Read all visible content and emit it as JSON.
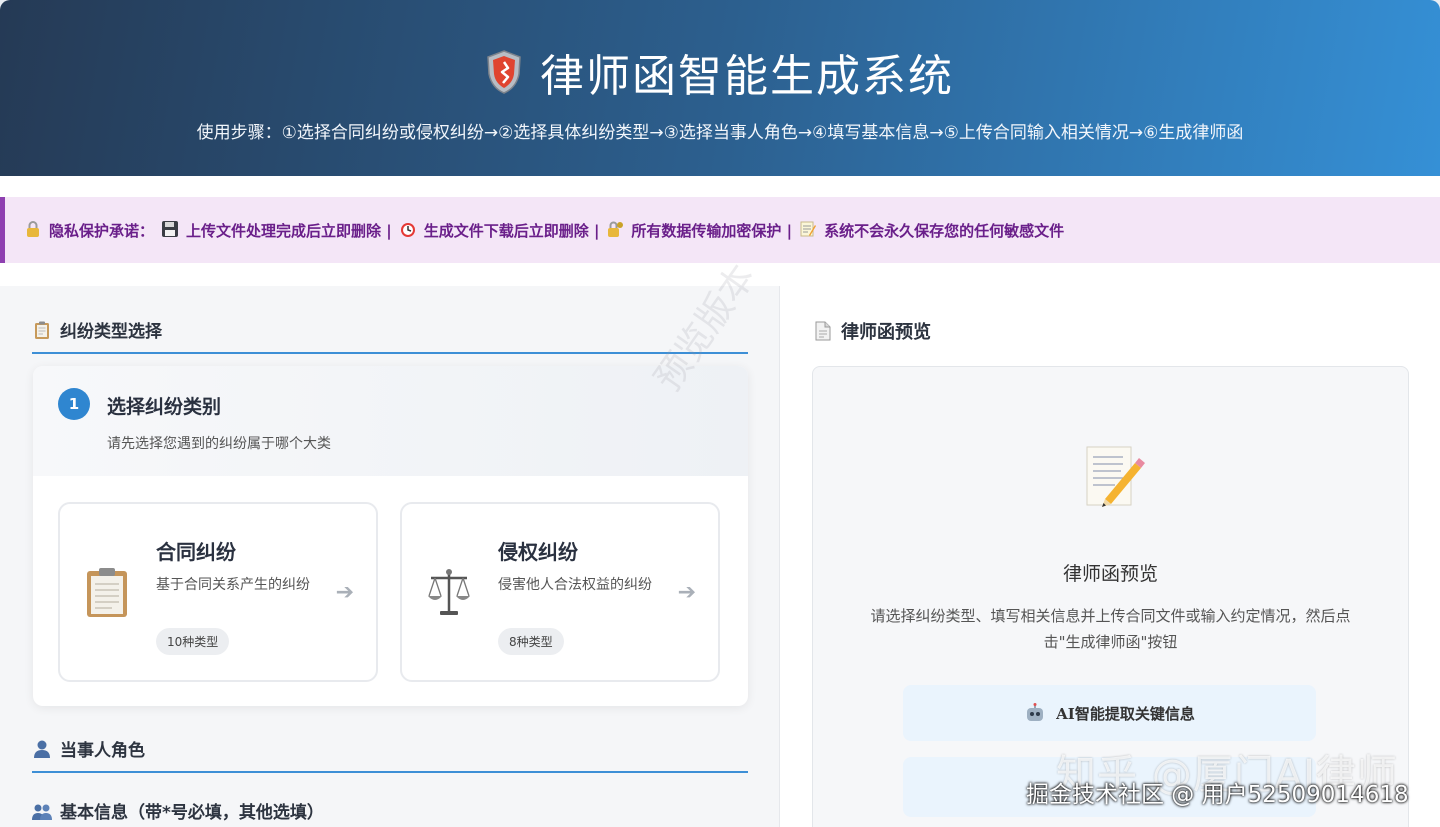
{
  "header": {
    "title": "律师函智能生成系统",
    "steps": "使用步骤：①选择合同纠纷或侵权纠纷→②选择具体纠纷类型→③选择当事人角色→④填写基本信息→⑤上传合同输入相关情况→⑥生成律师函"
  },
  "privacy": {
    "label": "隐私保护承诺：",
    "items": [
      "上传文件处理完成后立即删除 |",
      "生成文件下载后立即删除 |",
      "所有数据传输加密保护 |",
      "系统不会永久保存您的任何敏感文件"
    ],
    "icons": [
      "lock-icon",
      "floppy-disk-icon",
      "alarm-clock-icon",
      "locked-key-icon",
      "memo-icon"
    ]
  },
  "left": {
    "dispute_section": "纠纷类型选择",
    "step": {
      "number": "1",
      "title": "选择纠纷类别",
      "subtitle": "请先选择您遇到的纠纷属于哪个大类"
    },
    "types": [
      {
        "title": "合同纠纷",
        "desc": "基于合同关系产生的纠纷",
        "badge": "10种类型",
        "icon": "clipboard-icon"
      },
      {
        "title": "侵权纠纷",
        "desc": "侵害他人合法权益的纠纷",
        "badge": "8种类型",
        "icon": "scales-icon"
      }
    ],
    "role_section": "当事人角色",
    "basic_section": "基本信息（带*号必填，其他选填）"
  },
  "right": {
    "preview_section": "律师函预览",
    "preview_title": "律师函预览",
    "preview_desc": "请选择纠纷类型、填写相关信息并上传合同文件或输入约定情况，然后点击\"生成律师函\"按钮",
    "feature_1": "AI智能提取关键信息"
  },
  "watermarks": {
    "diagonal": "预览版本",
    "zhihu": "知乎 @厦门AI律师",
    "juejin": "掘金技术社区 @ 用户52509014618"
  },
  "colors": {
    "header_start": "#253a55",
    "header_end": "#3590d6",
    "accent": "#2f86d0",
    "privacy_bg": "#f4e6f7",
    "privacy_text": "#6a1f8a"
  }
}
